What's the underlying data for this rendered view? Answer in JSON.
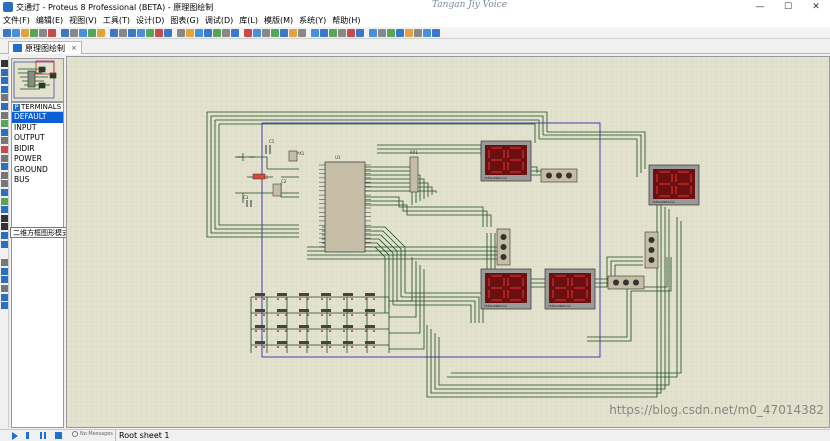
{
  "window": {
    "title": "交通灯 - Proteus 8 Professional (BETA) - 原理图绘制",
    "watermark": "Tangan Jiy Voice",
    "controls": [
      "—",
      "☐",
      "✕"
    ]
  },
  "menu": [
    "文件(F)",
    "编辑(E)",
    "视图(V)",
    "工具(T)",
    "设计(D)",
    "图表(G)",
    "调试(D)",
    "库(L)",
    "模版(M)",
    "系统(Y)",
    "帮助(H)"
  ],
  "tab": {
    "label": "原理图绘制",
    "close": "×"
  },
  "palette": {
    "badge": "P",
    "header": "TERMINALS",
    "items": [
      "DEFAULT",
      "INPUT",
      "OUTPUT",
      "BIDIR",
      "POWER",
      "GROUND",
      "BUS"
    ],
    "selected": "DEFAULT"
  },
  "tooltip": "二维方框图形模式",
  "status": {
    "messages": "No Messages",
    "sheet": "Root sheet 1",
    "url": "https://blog.csdn.net/m0_47014382"
  },
  "schematic": {
    "crystal_label": "X1",
    "cap1_label": "C1",
    "cap2_label": "C2",
    "cap3_label": "C3",
    "res_label": "R1",
    "mcu_label": "U1",
    "respack_label": "RP1",
    "display_label": "7SEG-MPX2-CA"
  },
  "colors": {
    "canvas": "#e3e2cf",
    "wire": "#1e4d1e",
    "border": "#1a1aa0",
    "chip": "#c5bda5",
    "display": "#7a1515"
  }
}
